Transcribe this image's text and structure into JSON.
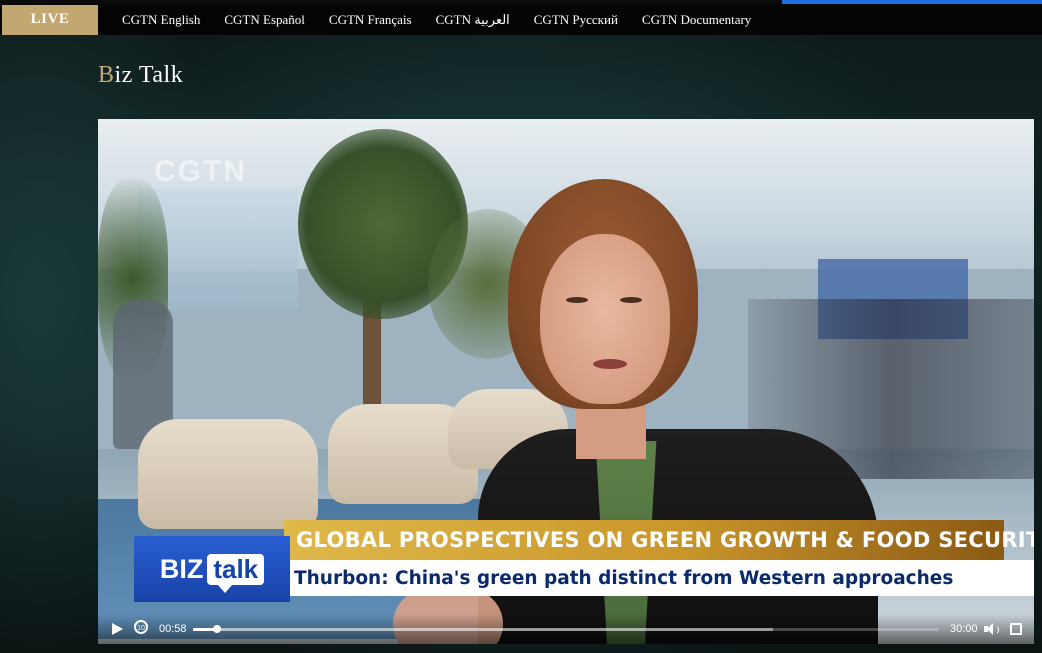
{
  "header": {
    "live_label": "LIVE",
    "nav": [
      {
        "label": "CGTN English"
      },
      {
        "label": "CGTN Español"
      },
      {
        "label": "CGTN Français"
      },
      {
        "label": "CGTN العربية"
      },
      {
        "label": "CGTN Русский"
      },
      {
        "label": "CGTN Documentary"
      }
    ]
  },
  "page": {
    "title_first_letter": "B",
    "title_rest": "iz Talk"
  },
  "video": {
    "watermark": "CGTN",
    "logo_biz": "BIZ",
    "logo_talk": "talk",
    "headline": "GLOBAL PROSPECTIVES ON GREEN GROWTH & FOOD SECURITY",
    "subheadline": "Thurbon: China's green path distinct from Western approaches",
    "replay_label": "10",
    "current_time": "00:58",
    "duration": "30:00",
    "progress_fraction": 0.032,
    "buffered_fraction": 0.778
  },
  "colors": {
    "live_bg": "#c2a870",
    "title_accent": "#c2a870",
    "headline_gold": "#c9962a",
    "subheadline_text": "#0b2a6b",
    "top_accent_blue": "#1e6fe0"
  }
}
